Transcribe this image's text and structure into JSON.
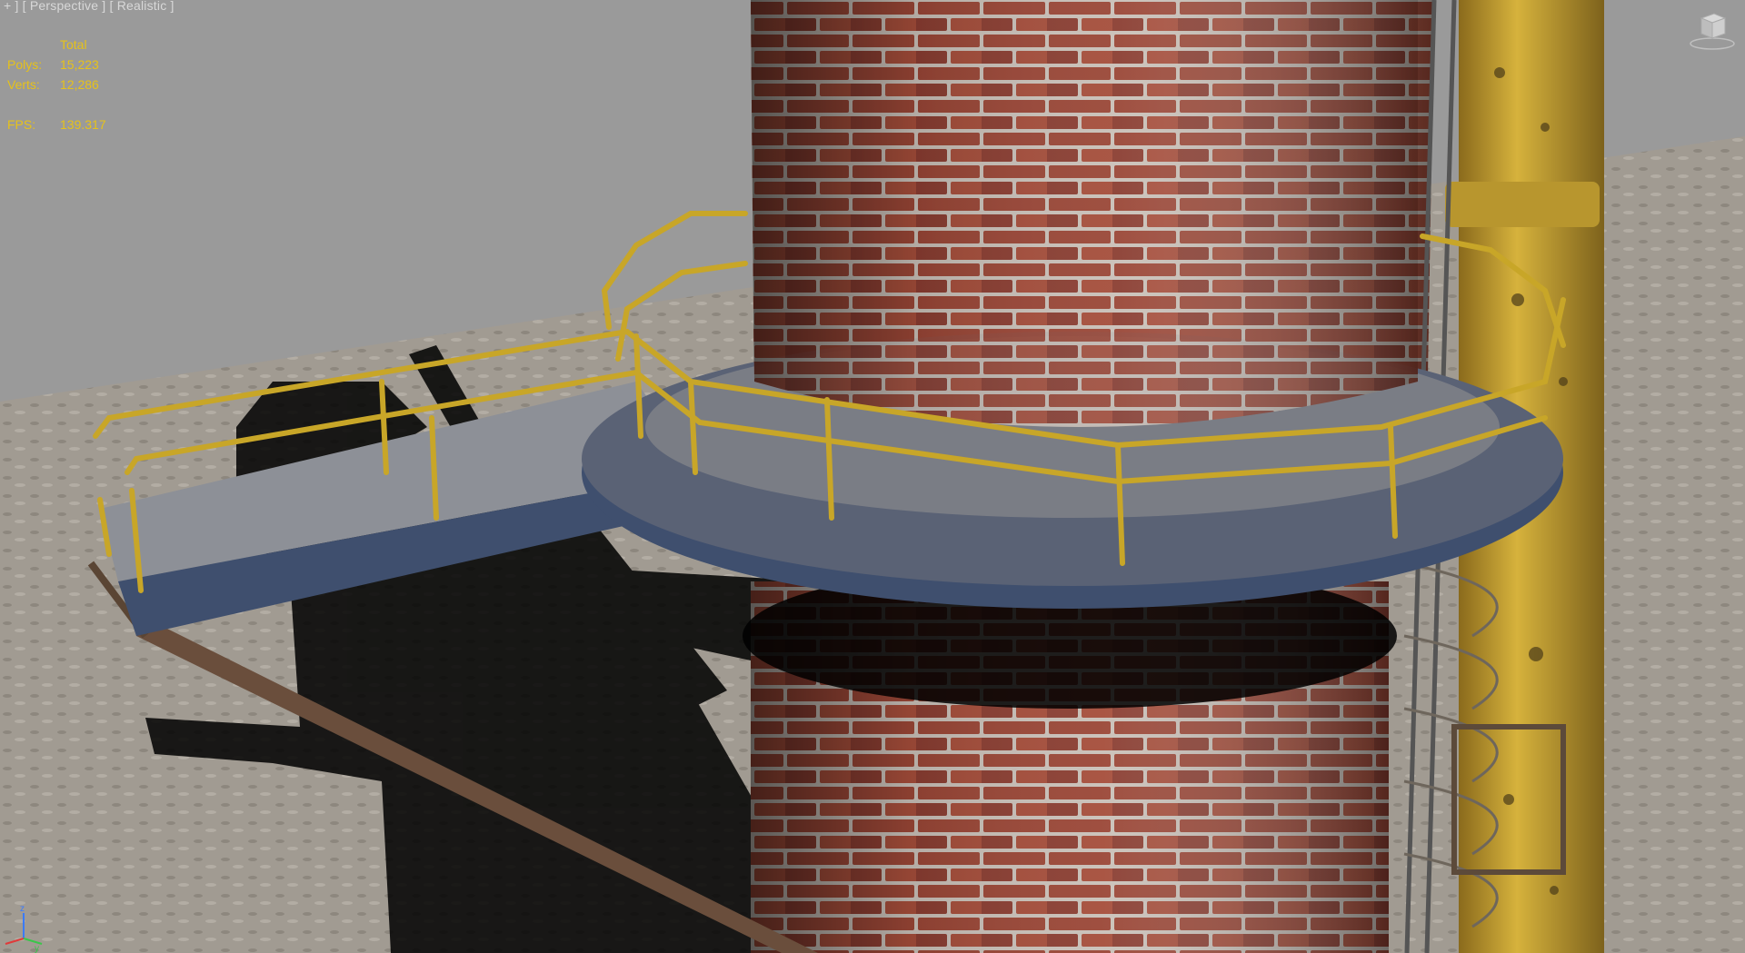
{
  "viewport": {
    "labels": [
      "+",
      "Perspective",
      "Realistic"
    ],
    "stats": {
      "header": "Total",
      "polys_label": "Polys:",
      "polys_value": "15,223",
      "verts_label": "Verts:",
      "verts_value": "12,286",
      "fps_label": "FPS:",
      "fps_value": "139.317"
    },
    "colors": {
      "sky": "#9a9a9a",
      "ground": "#a19b92",
      "brick": "#8b4533",
      "platform": "#3f4f6e",
      "railing": "#c8a628",
      "pipe": "#c9a436",
      "stats_text": "#e6c21a"
    },
    "icons": {
      "viewcube": "viewcube-icon",
      "axis": "axis-tripod-icon"
    }
  }
}
